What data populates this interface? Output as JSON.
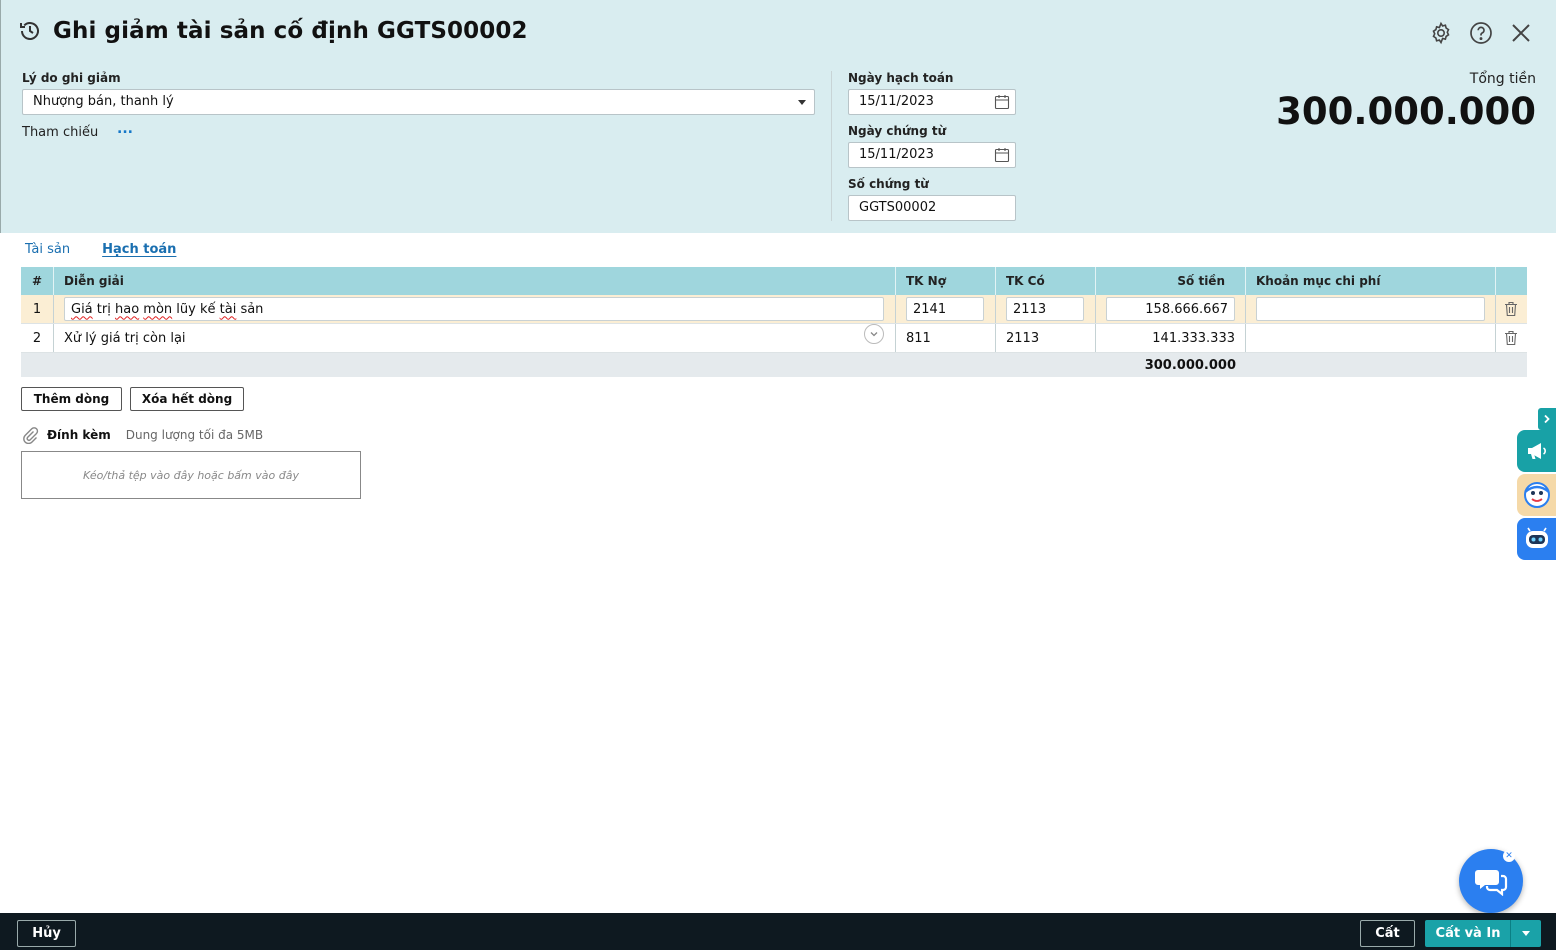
{
  "header": {
    "title": "Ghi giảm tài sản cố định GGTS00002",
    "reason_label": "Lý do ghi giảm",
    "reason_value": "Nhượng bán, thanh lý",
    "reference_label": "Tham chiếu",
    "reference_more": "...",
    "posting_date_label": "Ngày hạch toán",
    "posting_date": "15/11/2023",
    "voucher_date_label": "Ngày chứng từ",
    "voucher_date": "15/11/2023",
    "voucher_no_label": "Số chứng từ",
    "voucher_no": "GGTS00002",
    "total_label": "Tổng tiền",
    "total_value": "300.000.000"
  },
  "tabs": [
    {
      "label": "Tài sản",
      "active": false
    },
    {
      "label": "Hạch toán",
      "active": true
    }
  ],
  "grid": {
    "columns": [
      "#",
      "Diễn giải",
      "TK Nợ",
      "TK Có",
      "Số tiền",
      "Khoản mục chi phí"
    ],
    "rows": [
      {
        "no": "1",
        "desc_a": "Giá",
        "desc_b": " trị ",
        "desc_c": "hao",
        "desc_d": " ",
        "desc_e": "mòn",
        "desc_f": " lũy kế ",
        "desc_g": "tài",
        "desc_h": " sản",
        "debit": "2141",
        "credit": "2113",
        "amount": "158.666.667",
        "cost_item": ""
      },
      {
        "no": "2",
        "desc": "Xử lý giá trị còn lại",
        "debit": "811",
        "credit": "2113",
        "amount": "141.333.333",
        "cost_item": ""
      }
    ],
    "total": "300.000.000"
  },
  "actions": {
    "add_row": "Thêm dòng",
    "delete_all": "Xóa hết dòng"
  },
  "attachment": {
    "title": "Đính kèm",
    "note": "Dung lượng tối đa 5MB",
    "dropzone": "Kéo/thả tệp vào đây hoặc bấm vào đây"
  },
  "footer": {
    "cancel": "Hủy",
    "save": "Cất",
    "save_print": "Cất và In"
  },
  "colors": {
    "header_bg": "#d9edf0",
    "grid_head": "#9fd6dd",
    "selected_row": "#fbeed4",
    "accent": "#1aa2a8",
    "link": "#1a6fb0",
    "footer_bg": "#0e1920"
  }
}
